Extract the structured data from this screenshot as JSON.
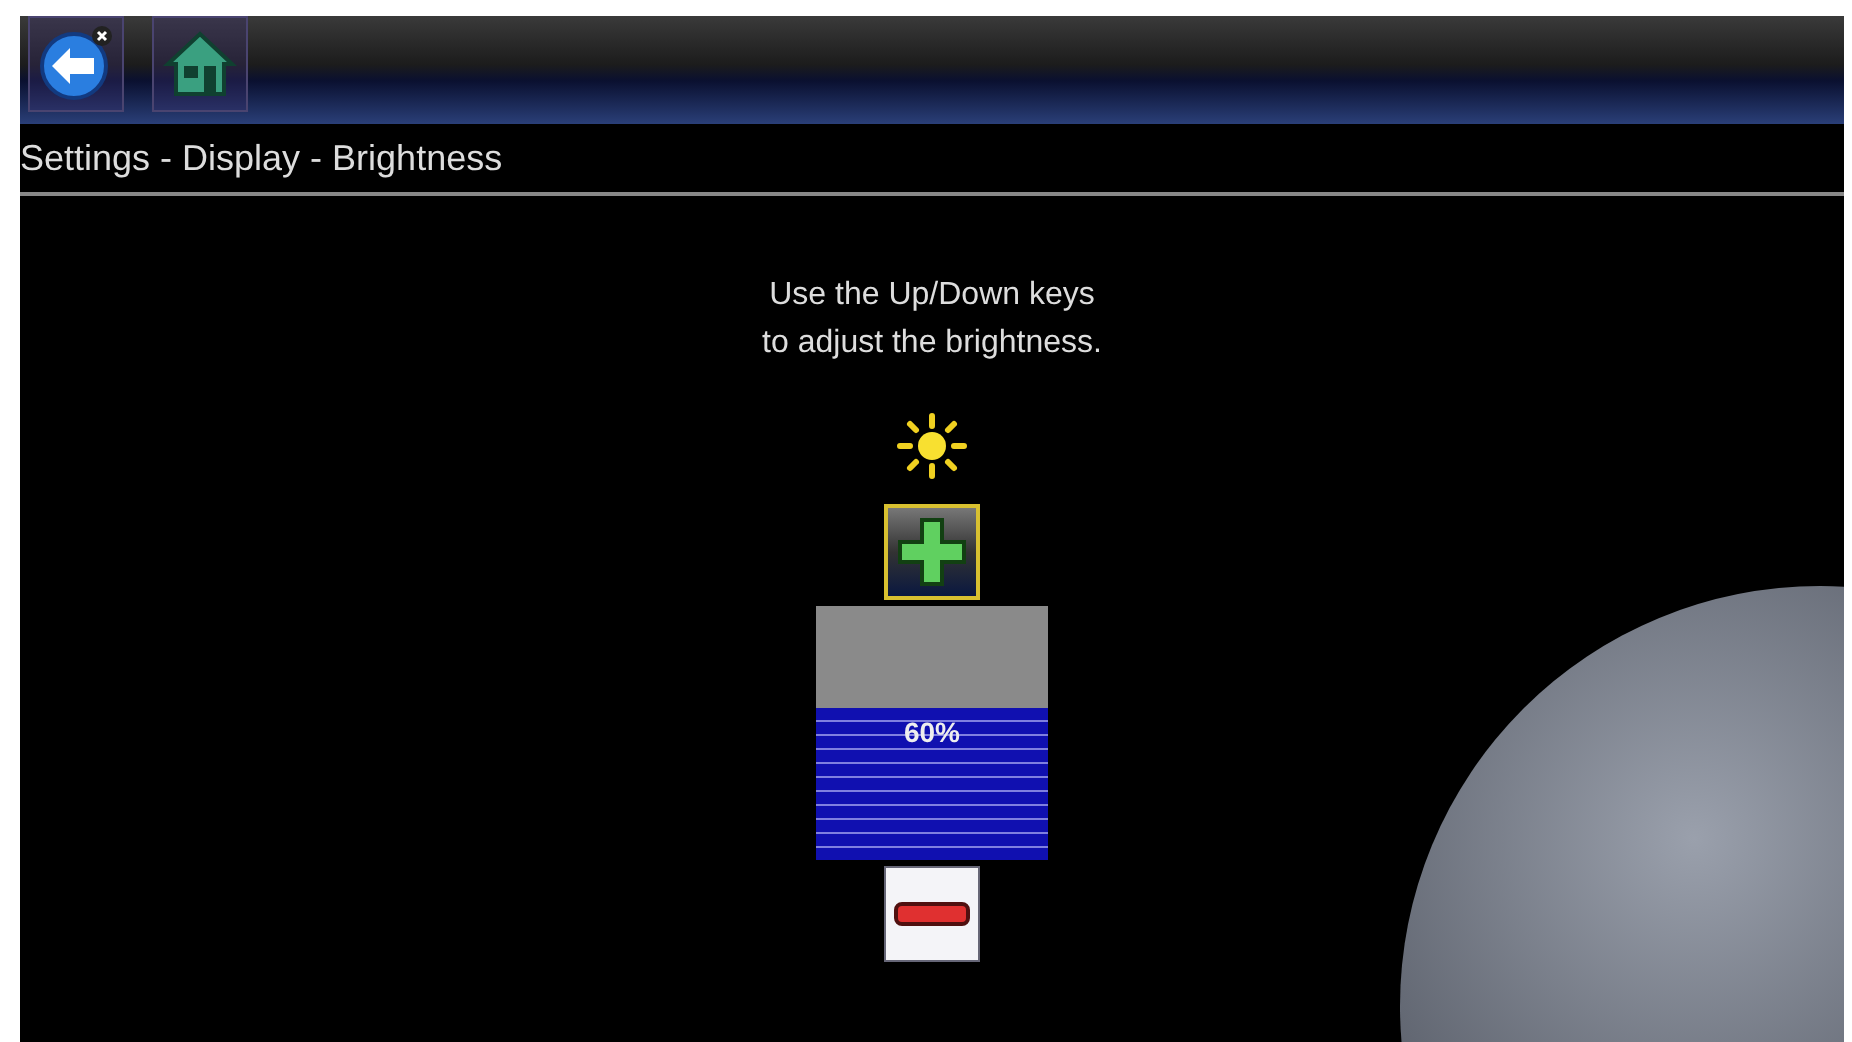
{
  "breadcrumb": "Settings - Display - Brightness",
  "instructions": [
    "Use the Up/Down keys",
    "to adjust the brightness."
  ],
  "brightness": {
    "level": 0.6,
    "reading": "60%"
  },
  "step_buttons": [
    {
      "kind": "increase",
      "highlighted": true
    },
    {
      "kind": "decrease",
      "highlighted": false
    }
  ]
}
